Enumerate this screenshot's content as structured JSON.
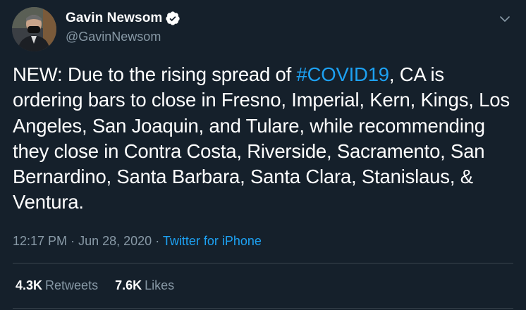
{
  "author": {
    "display_name": "Gavin Newsom",
    "handle": "@GavinNewsom",
    "verified": true,
    "avatar_icon": "profile-avatar"
  },
  "tweet": {
    "text_before_hashtag": "NEW: Due to the rising spread of ",
    "hashtag": "#COVID19",
    "text_after_hashtag": ", CA is ordering bars to close in Fresno, Imperial, Kern, Kings, Los Angeles, San Joaquin, and Tulare, while recommending they close in Contra Costa, Riverside, Sacramento, San Bernardino, Santa Barbara, Santa Clara, Stanislaus, & Ventura."
  },
  "meta": {
    "time": "12:17 PM",
    "separator": "·",
    "date": "Jun 28, 2020",
    "source": "Twitter for iPhone"
  },
  "stats": {
    "retweets_count": "4.3K",
    "retweets_label": "Retweets",
    "likes_count": "7.6K",
    "likes_label": "Likes"
  },
  "colors": {
    "background": "#15202b",
    "accent": "#1da1f2",
    "secondary_text": "#8899a6",
    "divider": "#38444d"
  },
  "icons": {
    "verified": "verified-badge-icon",
    "more": "chevron-down-icon"
  }
}
